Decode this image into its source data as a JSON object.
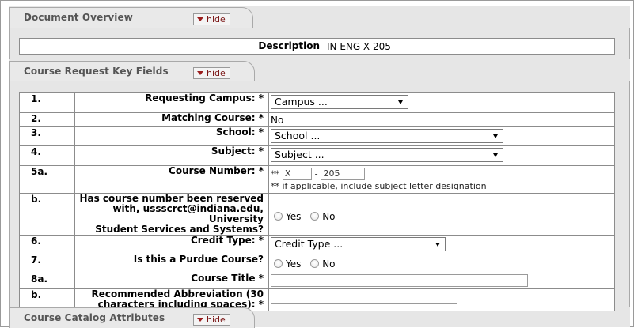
{
  "document_overview": {
    "title": "Document Overview",
    "hide_label": "hide",
    "description_label": "Description",
    "description_value": "IN ENG-X 205"
  },
  "key_fields": {
    "title": "Course Request Key Fields",
    "hide_label": "hide",
    "rows": {
      "campus": {
        "num": "1.",
        "label": "Requesting Campus: *",
        "select": "Campus ..."
      },
      "matching": {
        "num": "2.",
        "label": "Matching Course: *",
        "value": "No"
      },
      "school": {
        "num": "3.",
        "label": "School: *",
        "select": "School ..."
      },
      "subject": {
        "num": "4.",
        "label": "Subject: *",
        "select": "Subject ..."
      },
      "course_number": {
        "num": "5a.",
        "label": "Course Number: *",
        "prefix": "**",
        "letter": "X",
        "dash": "-",
        "number": "205",
        "hint": "** if applicable, include subject letter designation"
      },
      "reserved": {
        "num": "b.",
        "label_line1": "Has course number been reserved",
        "label_line2": "with, ussscrct@indiana.edu, University",
        "label_line3": "Student Services and Systems?",
        "yes": "Yes",
        "no": "No"
      },
      "credit": {
        "num": "6.",
        "label": "Credit Type: *",
        "select": "Credit Type ..."
      },
      "purdue": {
        "num": "7.",
        "label": "Is this a Purdue Course?",
        "yes": "Yes",
        "no": "No"
      },
      "course_title": {
        "num": "8a.",
        "label": "Course Title *",
        "value": ""
      },
      "abbrev": {
        "num": "b.",
        "label_line1": "Recommended Abbreviation (30",
        "label_line2": "characters including spaces): *",
        "value": ""
      }
    }
  },
  "catalog": {
    "title": "Course Catalog Attributes",
    "hide_label": "hide"
  }
}
